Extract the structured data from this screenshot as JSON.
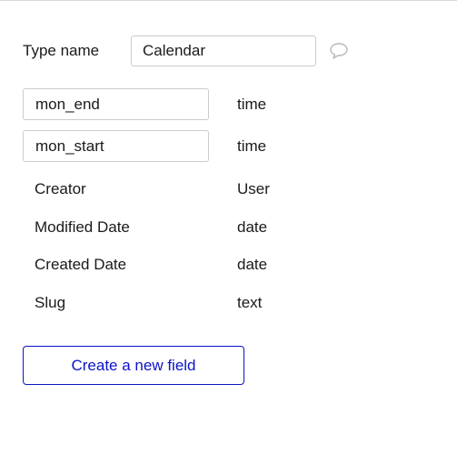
{
  "type_section": {
    "label": "Type name",
    "value": "Calendar",
    "comment_icon": "comment-bubble-icon"
  },
  "fields": [
    {
      "name": "mon_end",
      "type": "time",
      "editable": true
    },
    {
      "name": "mon_start",
      "type": "time",
      "editable": true
    },
    {
      "name": "Creator",
      "type": "User",
      "editable": false
    },
    {
      "name": "Modified Date",
      "type": "date",
      "editable": false
    },
    {
      "name": "Created Date",
      "type": "date",
      "editable": false
    },
    {
      "name": "Slug",
      "type": "text",
      "editable": false
    }
  ],
  "create_button_label": "Create a new field",
  "colors": {
    "accent": "#0c13c6",
    "input_border": "#cccccc",
    "icon": "#b8b8b8"
  }
}
